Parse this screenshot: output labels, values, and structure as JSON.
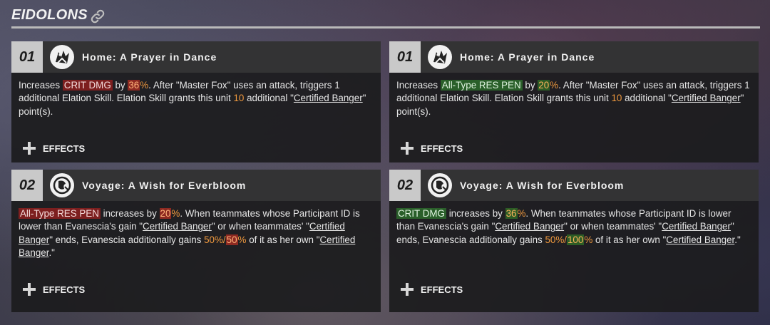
{
  "header": {
    "title": "EIDOLONS",
    "link_icon": "link-icon"
  },
  "cards": [
    {
      "num": "01",
      "title": "Home: A Prayer in Dance",
      "icon": "eidolon-1-icon",
      "p1": "Increases ",
      "stat": "CRIT DMG",
      "p2": " by ",
      "val": "36",
      "p3": ". After \"Master Fox\" uses an attack, triggers 1 additional Elation Skill. Elation Skill grants this unit ",
      "num2": "10",
      "p4": " additional \"",
      "term": "Certified Banger",
      "p5": "\" point(s).",
      "effects": "EFFECTS"
    },
    {
      "num": "01",
      "title": "Home: A Prayer in Dance",
      "icon": "eidolon-1-icon",
      "p1": "Increases ",
      "stat": "All-Type RES PEN",
      "p2": " by ",
      "val": "20",
      "p3": ". After \"Master Fox\" uses an attack, triggers 1 additional Elation Skill. Elation Skill grants this unit ",
      "num2": "10",
      "p4": " additional \"",
      "term": "Certified Banger",
      "p5": "\" point(s).",
      "effects": "EFFECTS"
    },
    {
      "num": "02",
      "title": "Voyage: A Wish for Everbloom",
      "icon": "eidolon-2-icon",
      "stat": "All-Type RES PEN",
      "p1": " increases by ",
      "val": "20",
      "p2": ". When teammates whose Participant ID is lower than Evanescia's gain \"",
      "term1": "Certified Banger",
      "p3": "\" or when teammates' \"",
      "term2": "Certified Banger",
      "p4": "\" ends, Evanescia additionally gains ",
      "base": "50%",
      "slash": "/",
      "val2": "50",
      "p5": " of it as her own \"",
      "term3": "Certified Banger",
      "p6": ".\"",
      "effects": "EFFECTS"
    },
    {
      "num": "02",
      "title": "Voyage: A Wish for Everbloom",
      "icon": "eidolon-2-icon",
      "stat": "CRIT DMG",
      "p1": " increases by ",
      "val": "36",
      "p2": ". When teammates whose Participant ID is lower than Evanescia's gain \"",
      "term1": "Certified Banger",
      "p3": "\" or when teammates' \"",
      "term2": "Certified Banger",
      "p4": "\" ends, Evanescia additionally gains ",
      "base": "50%",
      "slash": "/",
      "val2": "100",
      "p5": " of it as her own \"",
      "term3": "Certified Banger",
      "p6": ".\"",
      "effects": "EFFECTS"
    }
  ],
  "pct_symbol": "%",
  "colors": {
    "accent_orange": "#f0993e",
    "red_highlight": "#7d1f1f",
    "green_highlight": "#2a5f2a"
  }
}
